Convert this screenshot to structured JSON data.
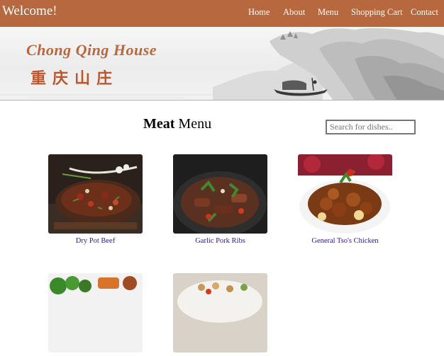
{
  "header": {
    "brand": "Welcome!",
    "nav": [
      {
        "label": "Home"
      },
      {
        "label": "About"
      },
      {
        "label": "Menu"
      },
      {
        "label": "Shopping Cart"
      },
      {
        "label": "Contact"
      }
    ]
  },
  "banner": {
    "name": "Chong Qing House",
    "chinese_name": "重庆山庄"
  },
  "main": {
    "heading_bold": "Meat",
    "heading_rest": " Menu",
    "search_placeholder": "Search for dishes.."
  },
  "dishes": [
    {
      "name": "Dry Pot Beef"
    },
    {
      "name": "Garlic Pork Ribs"
    },
    {
      "name": "General Tso's Chicken"
    },
    {
      "name": ""
    },
    {
      "name": ""
    }
  ],
  "colors": {
    "nav_bg": "#b8683e",
    "brand_text": "#b8683e",
    "dish_link": "#2b1a8f"
  }
}
